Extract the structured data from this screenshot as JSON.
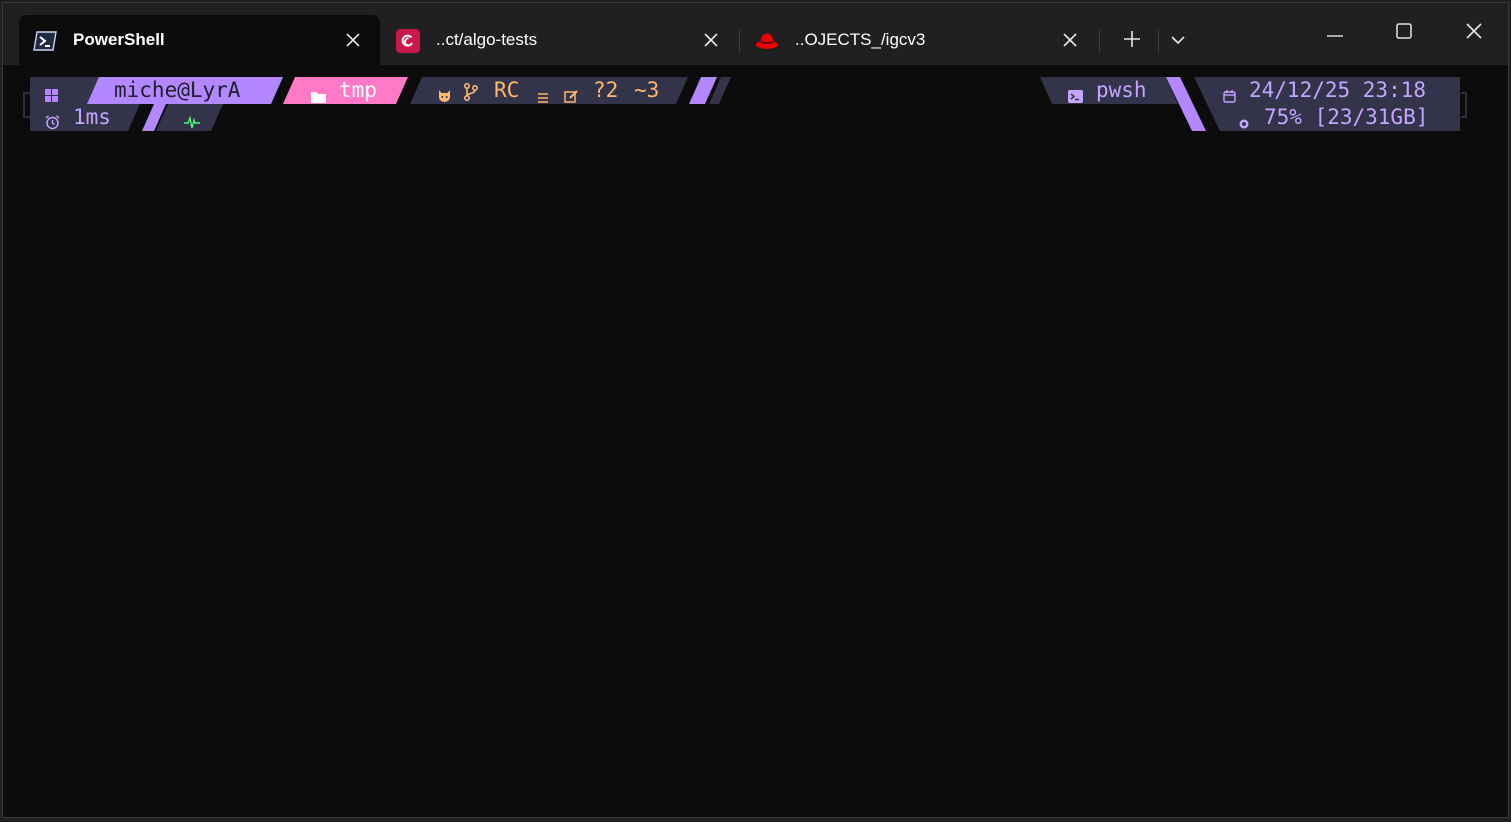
{
  "tabs": [
    {
      "label": "PowerShell",
      "icon": "powershell-icon",
      "active": true
    },
    {
      "label": "..ct/algo-tests",
      "icon": "debian-icon",
      "active": false
    },
    {
      "label": "..OJECTS_/igcv3",
      "icon": "redhat-icon",
      "active": false
    }
  ],
  "tabbar": {
    "new_tab_icon": "plus-icon",
    "dropdown_icon": "chevron-down-icon"
  },
  "window_controls": [
    "minimize-icon",
    "maximize-icon",
    "close-icon"
  ],
  "prompt": {
    "os_icon": "windows-icon",
    "user_host": "miche@LyrA",
    "path_icon": "folder-icon",
    "path": "tmp",
    "git": {
      "icons": [
        "github-icon",
        "branch-icon"
      ],
      "branch": "RC",
      "status_icon": "equal-icon",
      "edit_icon": "edit-icon",
      "untracked": "?2",
      "modified": "~3"
    },
    "shell_icon": "terminal-icon",
    "shell": "pwsh",
    "datetime_icon": "calendar-icon",
    "datetime": "24/12/25 23:18",
    "execution_icon": "alarm-icon",
    "execution_time": "1ms",
    "status_icon": "pulse-icon",
    "memory_icon": "memory-icon",
    "memory": "75% [23/31GB]"
  },
  "colors": {
    "terminal_bg": "#0c0c0c",
    "tabbar_bg": "#202020",
    "segment_dark": "#333349",
    "segment_purple": "#b388ff",
    "segment_pink": "#ff79c6",
    "text_purple": "#c3a6ff",
    "text_orange": "#ffb86c",
    "text_dark": "#1e1e2e",
    "status_green": "#50fa7b"
  }
}
